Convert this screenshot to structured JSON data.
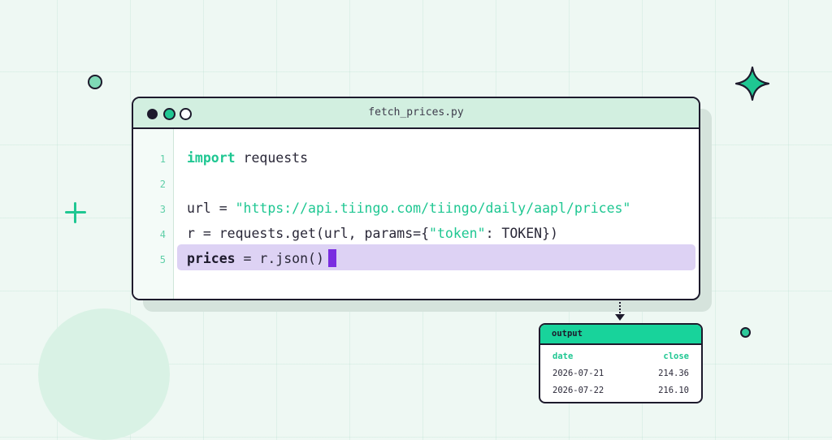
{
  "editor": {
    "filename": "fetch_prices.py",
    "lines": [
      {
        "number": "1",
        "code": "import requests"
      },
      {
        "number": "2",
        "code": ""
      },
      {
        "number": "3",
        "code": "url = \"https://api.tiingo.com/tiingo/daily/aapl/prices\""
      },
      {
        "number": "4",
        "code": "r = requests.get(url, params={\"token\": TOKEN})"
      },
      {
        "number": "5",
        "code": "prices = r.json()"
      }
    ],
    "tokens": {
      "import_kw": "import",
      "requests": " requests",
      "url_lhs": "url = ",
      "url_str": "\"https://api.tiingo.com/tiingo/daily/aapl/prices\"",
      "r_lhs": "r = requests.get(url, params={",
      "token_str": "\"token\"",
      "r_rhs": ": TOKEN})",
      "prices_var": "prices",
      "prices_rhs": " = r.json()"
    },
    "highlighted_line": "5"
  },
  "output": {
    "title": "output",
    "columns": [
      "date",
      "close"
    ],
    "rows": [
      {
        "date": "2026-07-21",
        "close": "214.36"
      },
      {
        "date": "2026-07-22",
        "close": "216.10"
      }
    ]
  },
  "colors": {
    "accent": "#1fc792",
    "ink": "#1d1a2c",
    "titlebar": "#d2efe0",
    "highlight": "#ddd2f4",
    "cursor": "#7a2de0",
    "output_header": "#18d39b"
  },
  "icons": [
    "plus-icon",
    "sparkle-icon",
    "window-close-dot",
    "window-minimize-dot",
    "window-maximize-dot"
  ]
}
